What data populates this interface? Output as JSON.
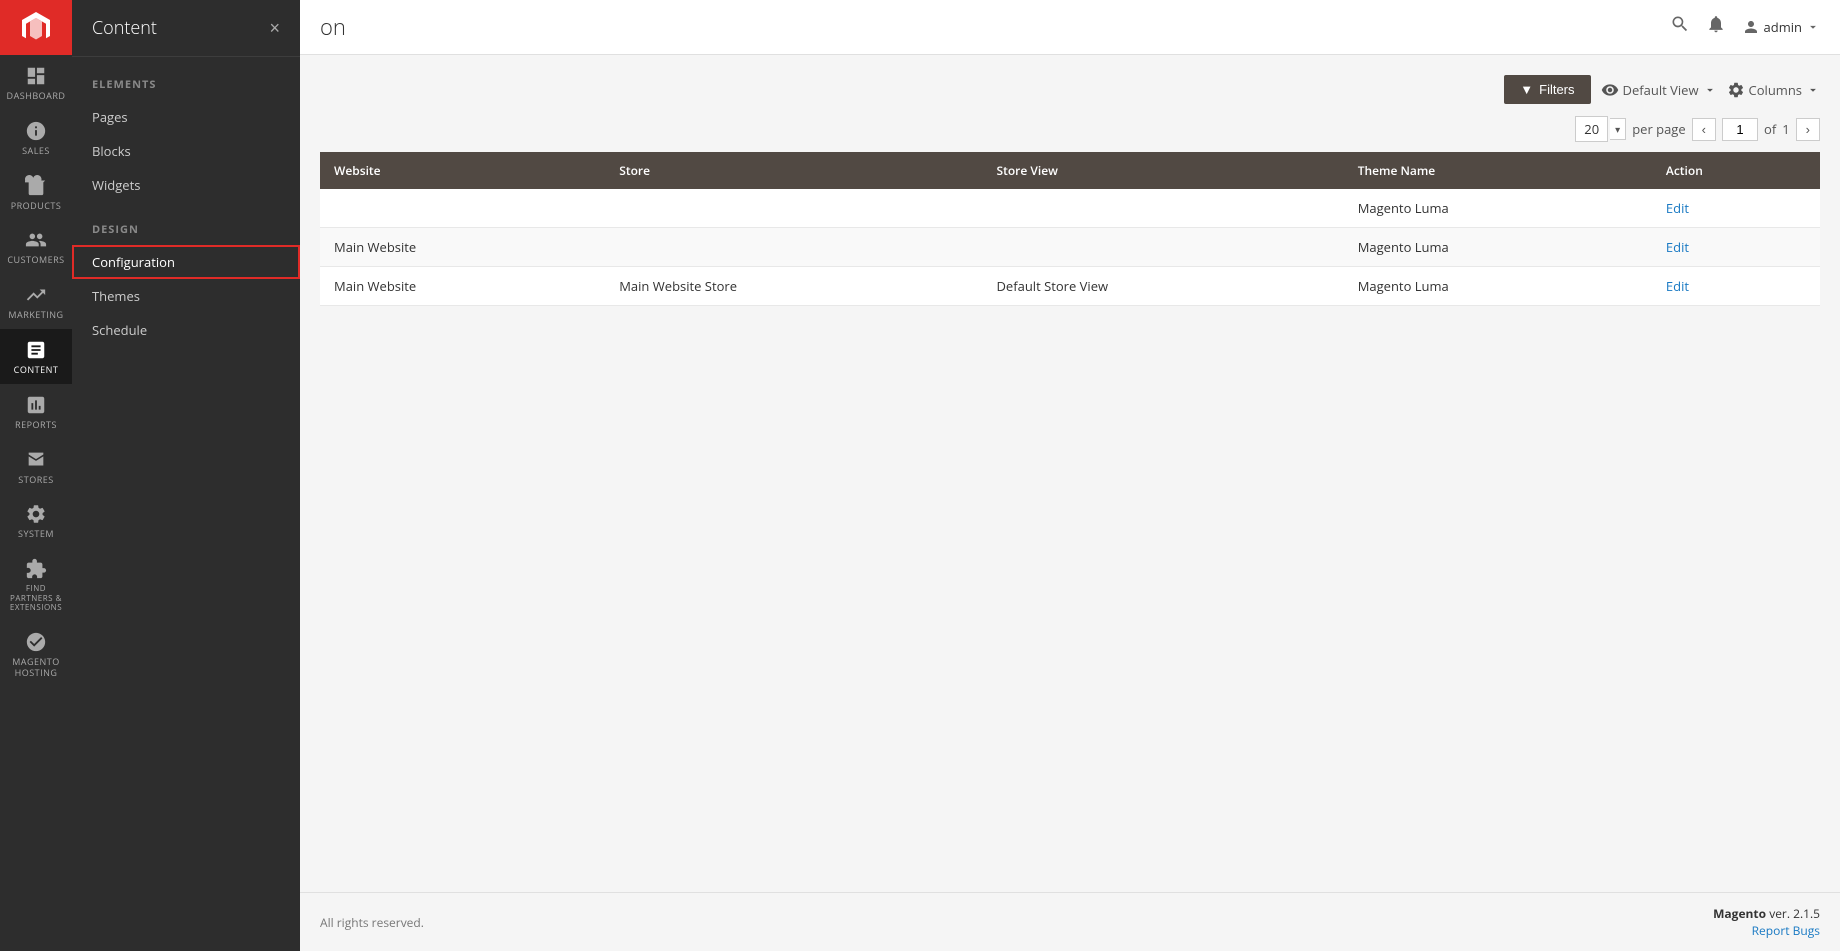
{
  "app": {
    "logo_alt": "Magento",
    "page_partial_title": "on"
  },
  "icon_nav": {
    "items": [
      {
        "id": "dashboard",
        "label": "DASHBOARD",
        "icon": "dashboard"
      },
      {
        "id": "sales",
        "label": "SALES",
        "icon": "sales"
      },
      {
        "id": "products",
        "label": "PRODUCTS",
        "icon": "products"
      },
      {
        "id": "customers",
        "label": "CUSTOMERS",
        "icon": "customers"
      },
      {
        "id": "marketing",
        "label": "MARKETING",
        "icon": "marketing"
      },
      {
        "id": "content",
        "label": "CONTENT",
        "icon": "content",
        "active": true
      },
      {
        "id": "reports",
        "label": "REPORTS",
        "icon": "reports"
      },
      {
        "id": "stores",
        "label": "STORES",
        "icon": "stores"
      },
      {
        "id": "system",
        "label": "SYSTEM",
        "icon": "system"
      },
      {
        "id": "extensions",
        "label": "FIND PARTNERS & EXTENSIONS",
        "icon": "extensions"
      },
      {
        "id": "hosting",
        "label": "MAGENTO HOSTING",
        "icon": "hosting"
      }
    ]
  },
  "flyout": {
    "title": "Content",
    "close_label": "×",
    "sections": [
      {
        "title": "Elements",
        "items": [
          {
            "id": "pages",
            "label": "Pages",
            "active": false
          },
          {
            "id": "blocks",
            "label": "Blocks",
            "active": false
          },
          {
            "id": "widgets",
            "label": "Widgets",
            "active": false
          }
        ]
      },
      {
        "title": "Design",
        "items": [
          {
            "id": "configuration",
            "label": "Configuration",
            "active": true
          },
          {
            "id": "themes",
            "label": "Themes",
            "active": false
          },
          {
            "id": "schedule",
            "label": "Schedule",
            "active": false
          }
        ]
      }
    ]
  },
  "top_bar": {
    "admin_label": "admin",
    "search_placeholder": "Search"
  },
  "toolbar": {
    "filters_label": "Filters",
    "view_label": "Default View",
    "columns_label": "Columns"
  },
  "pagination": {
    "per_page": "20",
    "per_page_label": "per page",
    "current_page": "1",
    "total_pages": "1"
  },
  "table": {
    "columns": [
      {
        "id": "website",
        "label": "Website"
      },
      {
        "id": "store",
        "label": "Store"
      },
      {
        "id": "store_view",
        "label": "Store View"
      },
      {
        "id": "theme_name",
        "label": "Theme Name"
      },
      {
        "id": "action",
        "label": "Action"
      }
    ],
    "rows": [
      {
        "website": "",
        "store": "",
        "store_view": "",
        "theme_name": "Magento Luma",
        "action": "Edit"
      },
      {
        "website": "Main Website",
        "store": "",
        "store_view": "",
        "theme_name": "Magento Luma",
        "action": "Edit"
      },
      {
        "website": "Main Website",
        "store": "Main Website Store",
        "store_view": "Default Store View",
        "theme_name": "Magento Luma",
        "action": "Edit"
      }
    ]
  },
  "footer": {
    "copyright": "All rights reserved.",
    "version_label": "Magento",
    "version_number": "ver. 2.1.5",
    "report_bugs_label": "Report Bugs"
  }
}
